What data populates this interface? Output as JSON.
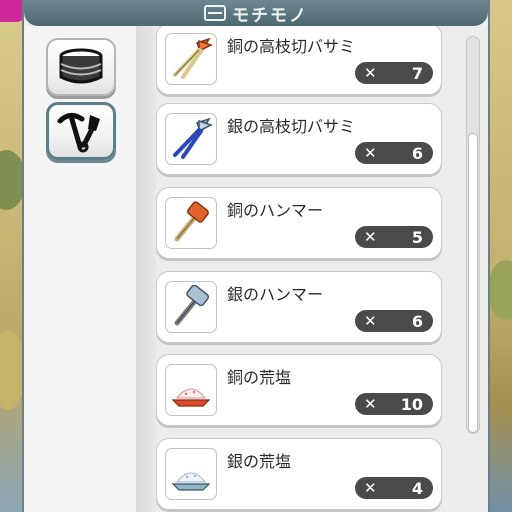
{
  "panel": {
    "title": "モチモノ",
    "tabs": [
      {
        "name": "materials",
        "icon": "tin-can-icon",
        "active": false
      },
      {
        "name": "tools",
        "icon": "pickaxe-shovel-icon",
        "active": true
      }
    ]
  },
  "items": [
    {
      "name": "銅の高枝切バサミ",
      "qty_prefix": "✕",
      "qty": "7",
      "icon": "copper-pruning-shears-icon"
    },
    {
      "name": "銀の高枝切バサミ",
      "qty_prefix": "✕",
      "qty": "6",
      "icon": "silver-pruning-shears-icon"
    },
    {
      "name": "銅のハンマー",
      "qty_prefix": "✕",
      "qty": "5",
      "icon": "copper-hammer-icon"
    },
    {
      "name": "銀のハンマー",
      "qty_prefix": "✕",
      "qty": "6",
      "icon": "silver-hammer-icon"
    },
    {
      "name": "銅の荒塩",
      "qty_prefix": "✕",
      "qty": "10",
      "icon": "copper-salt-icon"
    },
    {
      "name": "銀の荒塩",
      "qty_prefix": "✕",
      "qty": "4",
      "icon": "silver-salt-icon"
    }
  ],
  "colors": {
    "accent": "#5a7d86",
    "badge": "#4a4a4a",
    "copper": "#e0622c",
    "silver": "#8fb3c8"
  }
}
